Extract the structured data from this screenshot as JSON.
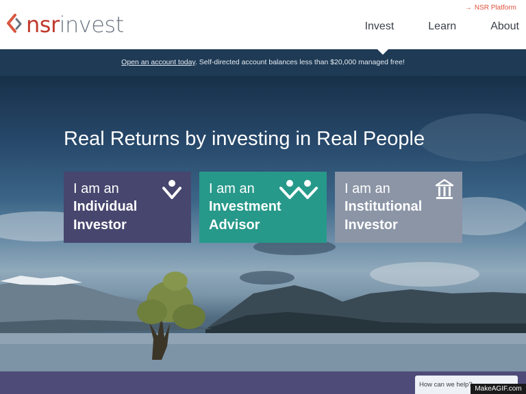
{
  "header": {
    "logo": {
      "nsr": "nsr",
      "invest": "invest"
    },
    "platform_link": "NSR Platform",
    "nav": [
      "Invest",
      "Learn",
      "About"
    ]
  },
  "notice": {
    "link": "Open an account today",
    "text": ". Self-directed account balances less than $20,000 managed free!"
  },
  "hero": {
    "headline": "Real Returns by investing in Real People",
    "cards": [
      {
        "line1": "I am an",
        "line2": "Individual",
        "line3": "Investor",
        "icon": "individual-person-icon",
        "color": "#46466e"
      },
      {
        "line1": "I am an",
        "line2": "Investment",
        "line3": "Advisor",
        "icon": "two-people-icon",
        "color": "#27998a"
      },
      {
        "line1": "I am an",
        "line2": "Institutional",
        "line3": "Investor",
        "icon": "institution-building-icon",
        "color": "#8b95a6"
      }
    ]
  },
  "help_widget": {
    "label": "How can we help?"
  },
  "watermark": "MakeAGIF.com",
  "colors": {
    "brand_red": "#c0392b",
    "notice_bg": "#1f3a55",
    "bottom_bar": "#4e4b79"
  }
}
